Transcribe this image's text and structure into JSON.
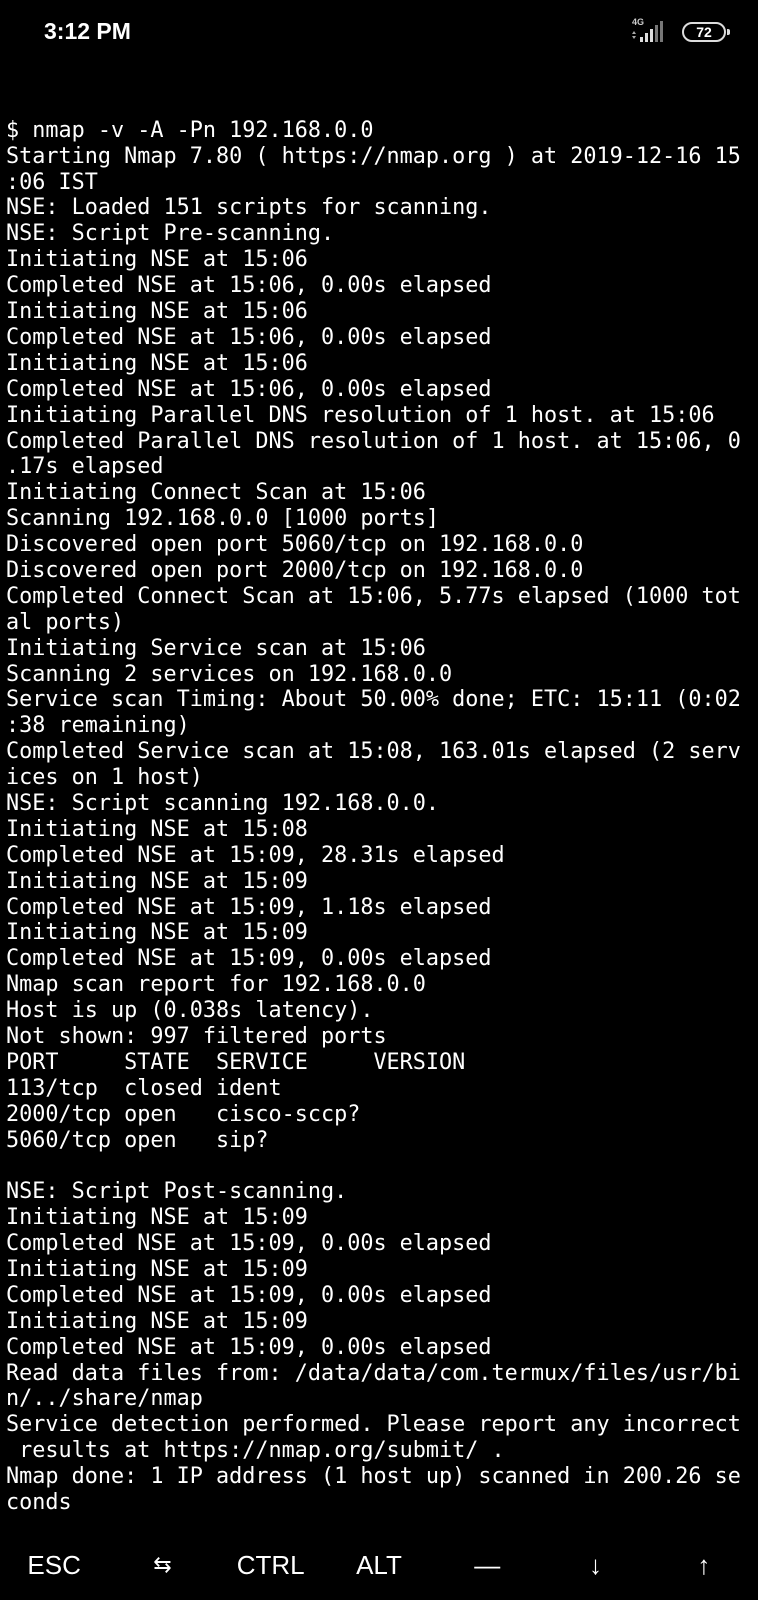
{
  "status_bar": {
    "time": "3:12 PM",
    "network_type": "4G",
    "battery_level": "72",
    "signal_icon": "cellular-signal-icon",
    "battery_icon": "battery-icon"
  },
  "terminal": {
    "lines": [
      "$ nmap -v -A -Pn 192.168.0.0",
      "Starting Nmap 7.80 ( https://nmap.org ) at 2019-12-16 15",
      ":06 IST",
      "NSE: Loaded 151 scripts for scanning.",
      "NSE: Script Pre-scanning.",
      "Initiating NSE at 15:06",
      "Completed NSE at 15:06, 0.00s elapsed",
      "Initiating NSE at 15:06",
      "Completed NSE at 15:06, 0.00s elapsed",
      "Initiating NSE at 15:06",
      "Completed NSE at 15:06, 0.00s elapsed",
      "Initiating Parallel DNS resolution of 1 host. at 15:06",
      "Completed Parallel DNS resolution of 1 host. at 15:06, 0",
      ".17s elapsed",
      "Initiating Connect Scan at 15:06",
      "Scanning 192.168.0.0 [1000 ports]",
      "Discovered open port 5060/tcp on 192.168.0.0",
      "Discovered open port 2000/tcp on 192.168.0.0",
      "Completed Connect Scan at 15:06, 5.77s elapsed (1000 tot",
      "al ports)",
      "Initiating Service scan at 15:06",
      "Scanning 2 services on 192.168.0.0",
      "Service scan Timing: About 50.00% done; ETC: 15:11 (0:02",
      ":38 remaining)",
      "Completed Service scan at 15:08, 163.01s elapsed (2 serv",
      "ices on 1 host)",
      "NSE: Script scanning 192.168.0.0.",
      "Initiating NSE at 15:08",
      "Completed NSE at 15:09, 28.31s elapsed",
      "Initiating NSE at 15:09",
      "Completed NSE at 15:09, 1.18s elapsed",
      "Initiating NSE at 15:09",
      "Completed NSE at 15:09, 0.00s elapsed",
      "Nmap scan report for 192.168.0.0",
      "Host is up (0.038s latency).",
      "Not shown: 997 filtered ports",
      "PORT     STATE  SERVICE     VERSION",
      "113/tcp  closed ident",
      "2000/tcp open   cisco-sccp?",
      "5060/tcp open   sip?",
      "",
      "NSE: Script Post-scanning.",
      "Initiating NSE at 15:09",
      "Completed NSE at 15:09, 0.00s elapsed",
      "Initiating NSE at 15:09",
      "Completed NSE at 15:09, 0.00s elapsed",
      "Initiating NSE at 15:09",
      "Completed NSE at 15:09, 0.00s elapsed",
      "Read data files from: /data/data/com.termux/files/usr/bi",
      "n/../share/nmap",
      "Service detection performed. Please report any incorrect",
      " results at https://nmap.org/submit/ .",
      "Nmap done: 1 IP address (1 host up) scanned in 200.26 se",
      "conds",
      "$"
    ],
    "prompt": "$ "
  },
  "extra_keys": {
    "esc": "ESC",
    "tab": "⇆",
    "ctrl": "CTRL",
    "alt": "ALT",
    "dash": "—",
    "down": "↓",
    "up": "↑"
  }
}
